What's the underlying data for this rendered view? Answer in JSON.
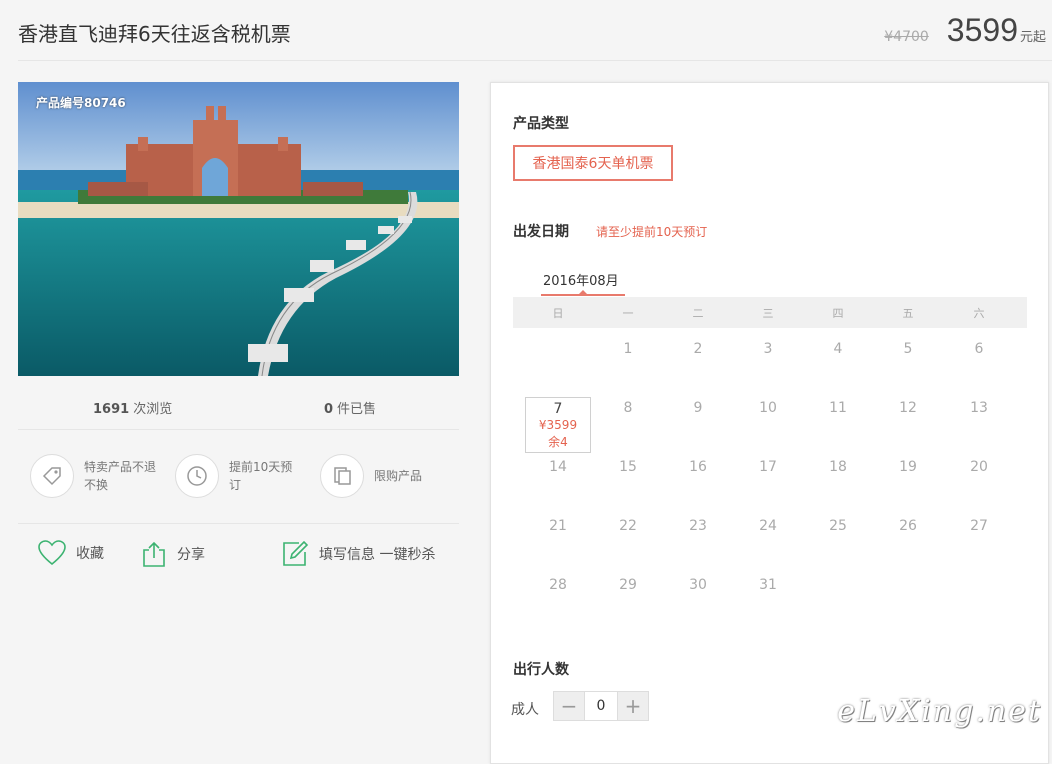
{
  "header": {
    "title": "香港直飞迪拜6天往返含税机票",
    "old_price": "¥4700",
    "price": "3599",
    "price_unit": "元起"
  },
  "photo": {
    "product_no": "产品编号80746"
  },
  "stats": {
    "views_count": "1691",
    "views_label": "次浏览",
    "sold_count": "0",
    "sold_label": "件已售"
  },
  "features": [
    {
      "icon": "tag-icon",
      "text": "特卖产品不退不换"
    },
    {
      "icon": "clock-icon",
      "text": "提前10天预订"
    },
    {
      "icon": "copy-icon",
      "text": "限购产品"
    }
  ],
  "actions": {
    "favorite": "收藏",
    "share": "分享",
    "fill_info": "填写信息 一键秒杀"
  },
  "panel": {
    "product_type_label": "产品类型",
    "product_type_option": "香港国泰6天单机票",
    "departure_label": "出发日期",
    "departure_note": "请至少提前10天预订",
    "month": "2016年08月",
    "weekdays": [
      "日",
      "一",
      "二",
      "三",
      "四",
      "五",
      "六"
    ],
    "days": [
      "1",
      "2",
      "3",
      "4",
      "5",
      "6",
      "7",
      "8",
      "9",
      "10",
      "11",
      "12",
      "13",
      "14",
      "15",
      "16",
      "17",
      "18",
      "19",
      "20",
      "21",
      "22",
      "23",
      "24",
      "25",
      "26",
      "27",
      "28",
      "29",
      "30",
      "31"
    ],
    "available_day": {
      "day": "7",
      "price": "¥3599",
      "remaining": "余4"
    },
    "travelers_label": "出行人数",
    "adult_label": "成人",
    "adult_count": "0",
    "minus": "−",
    "plus": "+"
  },
  "watermark": "eLvXing.net",
  "colors": {
    "accent": "#e4634f",
    "icon_green": "#3cb371"
  }
}
